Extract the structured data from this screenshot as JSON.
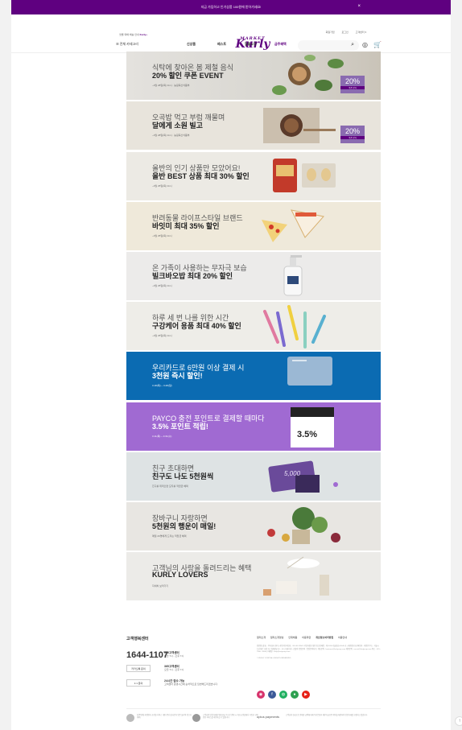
{
  "topbar": {
    "text": "지금 가입하고 인기상품 100원에 받아가세요!",
    "close": "×"
  },
  "header": {
    "delivery": "샛별·택배 배송 안내",
    "delivery_brand": "Kurly+",
    "util": [
      "회원가입",
      "로그인",
      "고객센터 ▾"
    ],
    "logo": "Kurly",
    "logo_crown": "MARKET"
  },
  "gnb": {
    "category": "☰  전체 카테고리",
    "menus": [
      "신상품",
      "베스트",
      "알뜰쇼핑",
      "금주혜택"
    ],
    "search_icon": "⌕",
    "location_icon": "◎",
    "cart_icon": "🛒"
  },
  "banners": [
    {
      "t1": "식탁에 찾아온 봄 제철 음식",
      "t2": "20% 할인 쿠폰 EVENT",
      "t3": "~3월 28일(목) 11시  ·  농림축산식품부",
      "badge": "20%",
      "badge_sub": "쿠폰 받기"
    },
    {
      "t1": "오곡밥 먹고 부럼 깨물며",
      "t2": "달에게 소원 빌고",
      "t3": "~3월 28일(목) 11시  ·  농림축산식품부",
      "badge": "20%",
      "badge_sub": "쿠폰 받기"
    },
    {
      "t1": "올반의 인기 상품만 모았어요!",
      "t2": "올반 BEST 상품 최대 30% 할인",
      "t3": "~3월 25일(목) 11시"
    },
    {
      "t1": "반려동물 라이프스타일 브랜드",
      "t2": "바잇미 최대 35% 할인",
      "t3": "~3월 25일(목) 11시"
    },
    {
      "t1": "온 가족이 사용하는 무자극 보습",
      "t2": "빌크바오밥 최대 20% 할인",
      "t3": "~3월 25일(목) 11시"
    },
    {
      "t1": "하루 세 번 나를 위한 시간",
      "t2": "구강케어 용품 최대 40% 할인",
      "t3": "~3월 25일(목) 11시"
    },
    {
      "t1": "우리카드로 6만원 이상 결제 시",
      "t2": "3천원 즉시 할인!",
      "t3": "3.18(목) ~ 3.28(일)"
    },
    {
      "t1": "PAYCO 충전 포인트로 결제할 때마다",
      "t2": "3.5% 포인트 적립!",
      "t3": "3.11(목) ~ 3.31(수)",
      "badge": "3.5%"
    },
    {
      "t1": "친구 초대하면",
      "t2": "친구도 나도 5천원씩",
      "t3": "친구를 데려오면 모두를 적립금 혜택",
      "card": "5,000"
    },
    {
      "t1": "장바구니 자랑하면",
      "t2": "5천원의 행운이 매일!",
      "t3": "매일 20명에게 드리는 적립금 혜택"
    },
    {
      "t1": "고객님의 사랑을 돌려드리는 혜택",
      "t2": "KURLY LOVERS",
      "t3": "자세히 보러가기"
    }
  ],
  "footer": {
    "cs_title": "고객행복센터",
    "phone": "1644-1107",
    "phone_info_title": "365고객센터",
    "phone_info": "오전 7시 - 오후 7시",
    "kakao_button": "카카오톡 문의",
    "kakao_info_title": "365고객센터",
    "kakao_info": "오전 7시 - 오후 7시",
    "inquiry_button": "1:1 문의",
    "inquiry_info_title": "24시간 접수 가능",
    "inquiry_info": "고객센터 운영시간에 순차적으로 답변해드리겠습니다.",
    "links": [
      "컬리소개",
      "컬리소개영상",
      "인재채용",
      "이용약관",
      "개인정보처리방침",
      "이용안내"
    ],
    "company_text": "법인명 (상호) : 주식회사 컬리 | 사업자등록번호 : 261-81-23567 사업자정보 확인 통신판매업 : 제 2018-서울강남-01646 호 | 개인정보보호책임자 : 이원준 주소 : 서울시 도산대로 16길 20, 이래빌딩 B1 ~ 4F | 대표이사 : 김슬아 입점문의 : 입점문의하기 | 제휴문의 : business@kurlycorp.com 채용문의 : recruit@kurlycorp.com 팩스 : 070 - 7500 - 6098 | 이메일 : help@kurlycorp.com",
    "copyright": "© KURLY CORP. ALL RIGHTS RESERVED",
    "social": [
      "◉",
      "f",
      "◍",
      "●",
      "▶"
    ],
    "cert1": "[인증범위] 마켓컬리 쇼핑몰 서비스 개발·운영 (심사받지 않은 물리적 인프라 제외)",
    "cert2": "고객님의 안전거래를 위해 현금 등으로 결제 시 저희 쇼핑몰에서 가입한 구매안전 서비스를 이용하실 수 있습니다.",
    "cert3_brand": "uplus payments",
    "cert3": "고객님이 현금으로 결제한 금액에 대해 우리은행과 채무지급보증 계약을 체결하여 안전거래를 보장하고 있습니다."
  },
  "colors": {
    "brand": "#5f0080",
    "woori": "#0071bc",
    "payco": "#a06ad2"
  }
}
